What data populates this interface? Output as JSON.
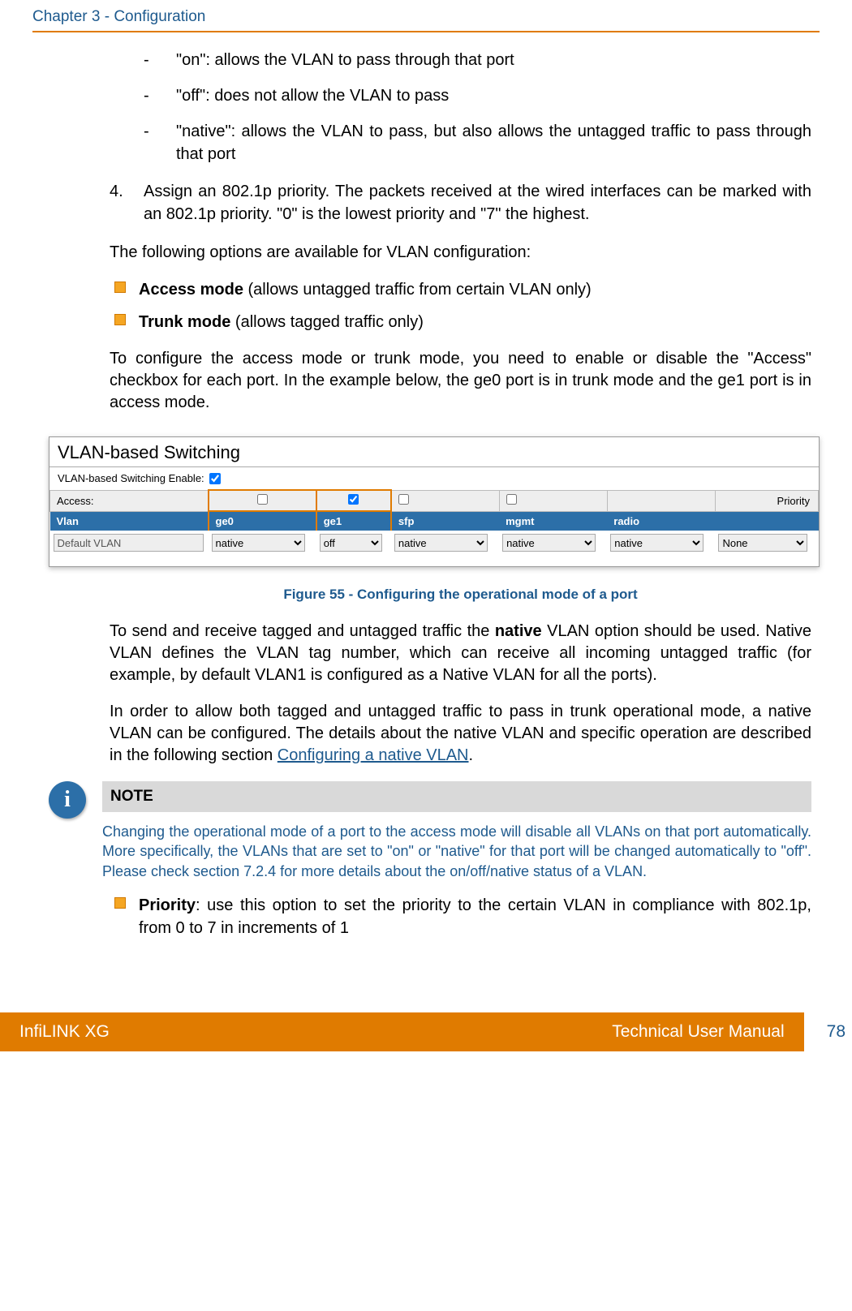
{
  "header": {
    "chapter": "Chapter 3 - Configuration"
  },
  "dash_items": {
    "d1": "\"on\": allows the VLAN to pass through that port",
    "d2": "\"off\": does not allow the VLAN to pass",
    "d3": "\"native\": allows the VLAN to pass, but also allows the untagged traffic to pass through that port"
  },
  "num_item": {
    "n": "4.",
    "text": "Assign an 802.1p priority. The packets received at the wired interfaces can be marked with an 802.1p priority. \"0\" is the lowest priority and \"7\" the highest."
  },
  "p_options": "The following options are available for VLAN configuration:",
  "bullets1": {
    "b1_bold": "Access mode",
    "b1_rest": " (allows untagged traffic from certain VLAN only)",
    "b2_bold": "Trunk mode",
    "b2_rest": " (allows tagged traffic only)"
  },
  "p_config": "To configure the access mode or trunk mode, you need to enable or disable the \"Access\" checkbox  for each port. In the example below, the ge0 port is in trunk mode and the ge1 port is in access mode.",
  "vlan_panel": {
    "title": "VLAN-based Switching",
    "enable_label": "VLAN-based Switching Enable:",
    "access_label": "Access:",
    "priority_label": "Priority",
    "cols": {
      "vlan": "Vlan",
      "ge0": "ge0",
      "ge1": "ge1",
      "sfp": "sfp",
      "mgmt": "mgmt",
      "radio": "radio"
    },
    "row": {
      "name": "Default VLAN",
      "ge0": "native",
      "ge1": "off",
      "sfp": "native",
      "mgmt": "native",
      "radio": "native",
      "prio": "None"
    }
  },
  "fig_caption": "Figure 55 - Configuring the operational mode of a port",
  "p_native1a": "To send and receive  tagged and untagged traffic the ",
  "p_native1_bold": "native",
  "p_native1b": " VLAN option should be used. Native VLAN  defines the  VLAN tag number, which  can receive all incoming untagged traffic (for example, by default VLAN1 is configured as a Native VLAN for all the ports).",
  "p_native2a": "In order to allow both tagged and untagged traffic to pass in trunk operational mode, a native VLAN can be configured. The details about the native VLAN and specific operation are described in the following section ",
  "p_native2_link": "Configuring a native VLAN",
  "p_native2b": ".",
  "note": {
    "title": "NOTE",
    "body": "Changing the operational mode of a port to the access mode will disable all VLANs on that port automatically. More specifically, the VLANs that are set to \"on\" or \"native\" for that port will be changed automatically to \"off\". Please check section 7.2.4 for more details about the on/off/native status of a VLAN."
  },
  "bullet_priority": {
    "bold": "Priority",
    "rest": ": use this option to set the priority to the certain VLAN in compliance with 802.1p, from 0 to 7 in increments of 1"
  },
  "footer": {
    "left": "InfiLINK XG",
    "right": "Technical User Manual",
    "page": "78"
  }
}
